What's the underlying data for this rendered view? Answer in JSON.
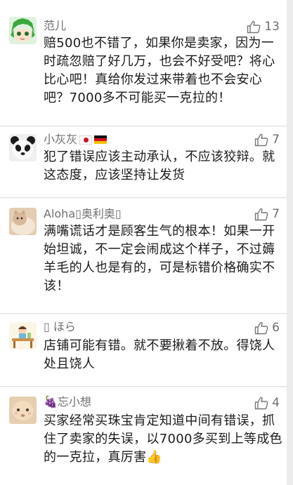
{
  "comments": [
    {
      "author": "范儿",
      "likes": "13",
      "text": "赔500也不错了，如果你是卖家，因为一时疏忽赔了好几万，也会不好受吧？将心比心吧！真给你发过来带着也不会安心吧？7000多不可能买一克拉的！",
      "avatar_icon": "green-hair-anime-avatar"
    },
    {
      "author": "小灰灰",
      "likes": "7",
      "text": "犯了错误应该主动承认，不应该狡辩。就这态度，应该坚持让发货",
      "avatar_icon": "panda-avatar",
      "flags": [
        "japan-flag-icon",
        "germany-flag-icon"
      ]
    },
    {
      "author": "Aloha▯奥利奥▯",
      "likes": "7",
      "text": "满嘴谎话才是顾客生气的根本！如果一开始坦诚，不一定会闹成这个样子，不过薅羊毛的人也是有的，可是标错价格确实不该！",
      "avatar_icon": "cat-photo-avatar"
    },
    {
      "author": "▯ ほら",
      "likes": "6",
      "text": "店铺可能有错。就不要揪着不放。得饶人处且饶人",
      "avatar_icon": "cartoon-desk-avatar"
    },
    {
      "author": "🍇忘小想",
      "likes": "4",
      "text": "买家经常买珠宝肯定知道中间有错误，抓住了卖家的失误，以7000多买到上等成色的一克拉，真厉害👍",
      "avatar_icon": "doll-face-avatar"
    }
  ],
  "colors": {
    "background": "#f4f4f4",
    "card": "#ffffff",
    "author_text": "#6f6f6f",
    "body_text": "#1b1b1b"
  }
}
